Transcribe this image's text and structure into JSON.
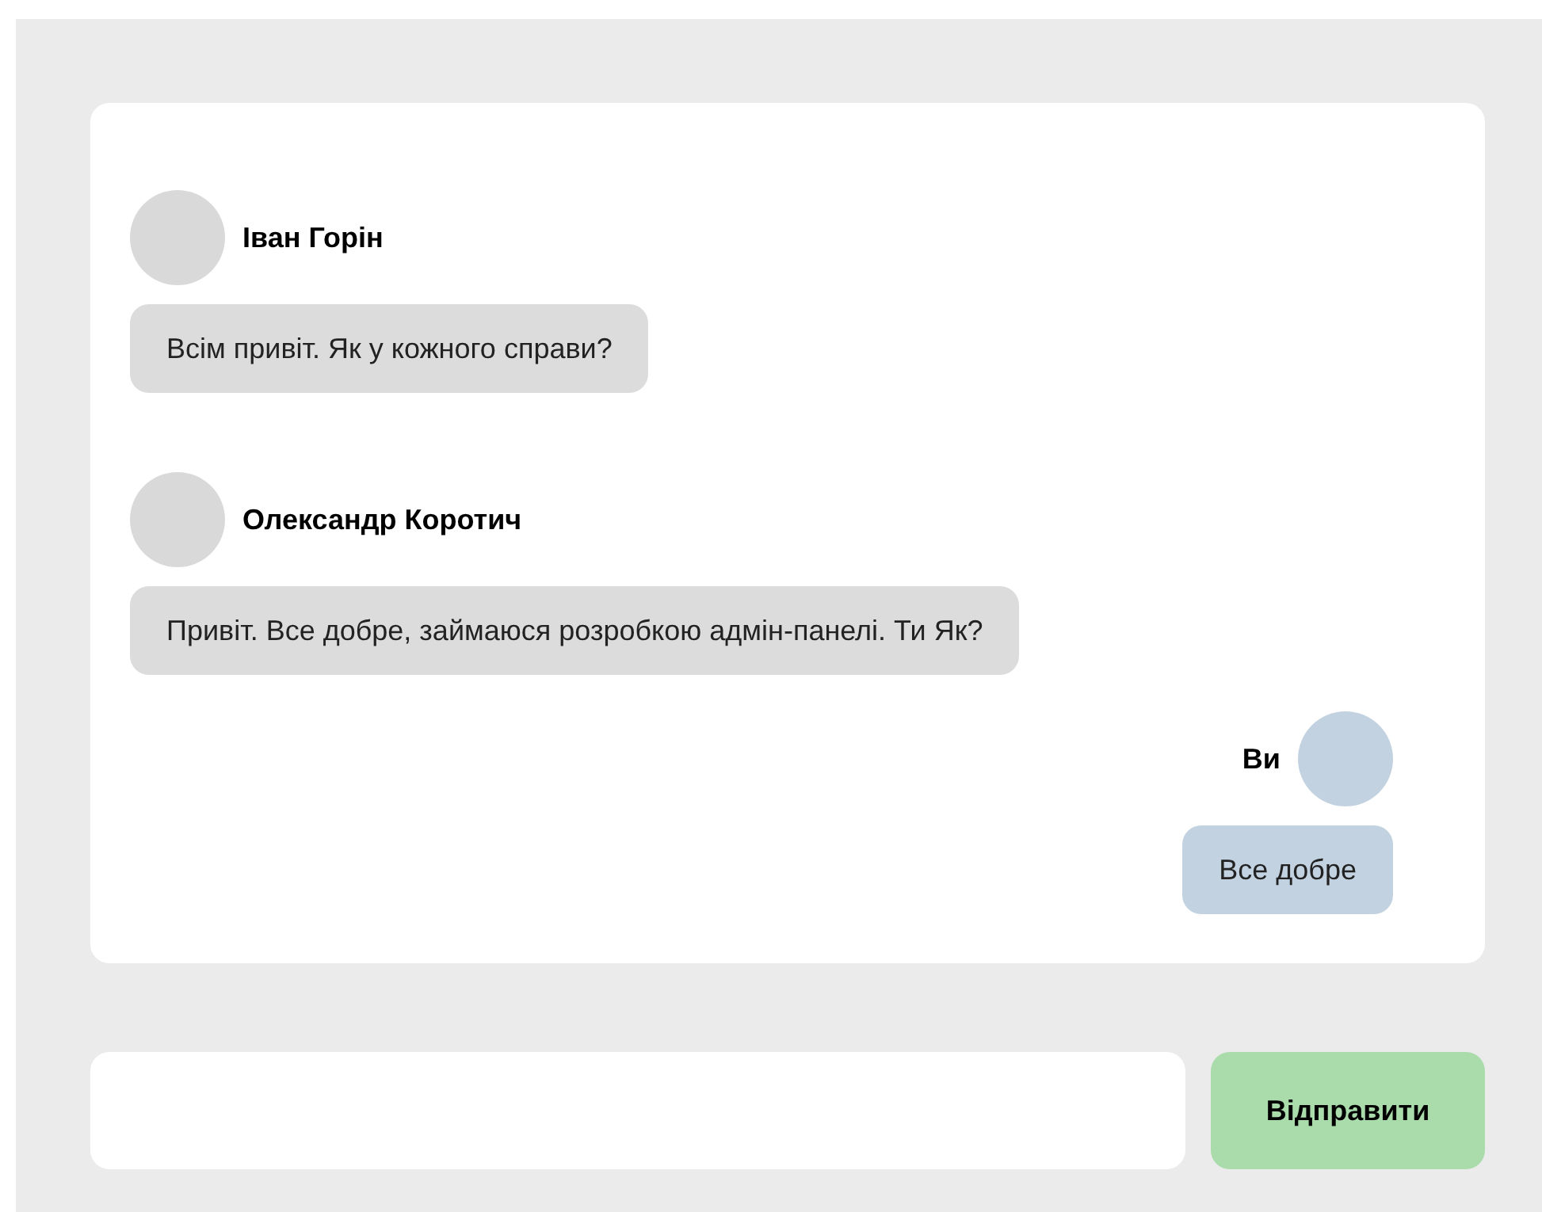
{
  "messages": [
    {
      "author": "Іван Горін",
      "text": "Всім привіт. Як у кожного справи?",
      "kind": "incoming"
    },
    {
      "author": "Олександр Коротич",
      "text": "Привіт. Все добре, займаюся розробкою адмін-панелі. Ти Як?",
      "kind": "incoming"
    },
    {
      "author": "Ви",
      "text": "Все добре",
      "kind": "outgoing"
    }
  ],
  "send_button": {
    "label": "Відправити"
  }
}
